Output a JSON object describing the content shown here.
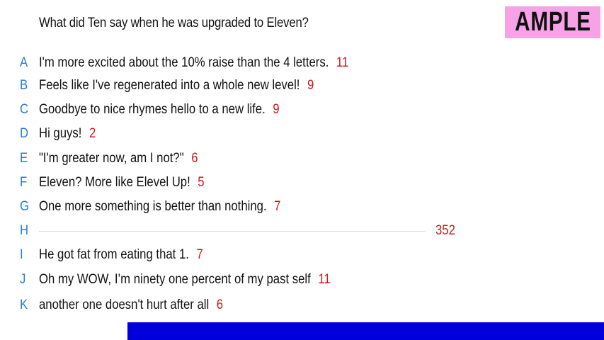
{
  "question": "What did Ten say when he was upgraded to Eleven?",
  "logo": "AMPLE",
  "answers": [
    {
      "letter": "A",
      "text": "I'm more excited about the 10% raise than the 4 letters.",
      "score": "11"
    },
    {
      "letter": "B",
      "text": "Feels like I've regenerated into a whole new level!",
      "score": "9"
    },
    {
      "letter": "C",
      "text": "Goodbye to nice rhymes hello to a new life.",
      "score": "9"
    },
    {
      "letter": "D",
      "text": "Hi guys!",
      "score": "2"
    },
    {
      "letter": "E",
      "text": "\"I'm greater now, am I not?\"",
      "score": "6"
    },
    {
      "letter": "F",
      "text": "Eleven? More like Elevel Up!",
      "score": "5"
    },
    {
      "letter": "G",
      "text": "One more something is better than nothing.",
      "score": "7"
    },
    {
      "letter": "H",
      "text": "",
      "score": "352"
    },
    {
      "letter": "I",
      "text": "He got fat from eating that 1.",
      "score": "7"
    },
    {
      "letter": "J",
      "text": "Oh my WOW, I’m ninety one percent of my past self",
      "score": "11"
    },
    {
      "letter": "K",
      "text": "another one doesn't hurt after all",
      "score": "6"
    }
  ],
  "colors": {
    "letter": "#2a7bd8",
    "score": "#d01818",
    "logo_bg": "#f7a2e6",
    "footer_bar": "#0000dc"
  }
}
